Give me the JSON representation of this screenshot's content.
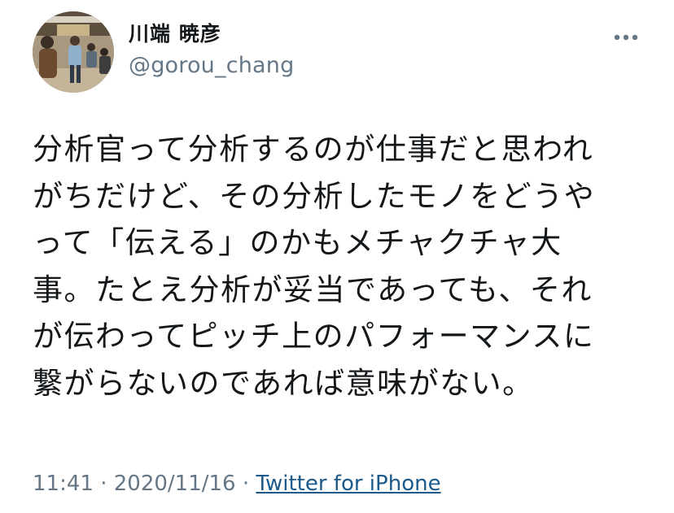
{
  "user": {
    "display_name": "川端 暁彦",
    "handle": "@gorou_chang"
  },
  "more_icon": "more-horizontal-icon",
  "tweet": {
    "text": "分析官って分析するのが仕事だと思われ\nがちだけど、その分析したモノをどうや\nって「伝える」のかもメチャクチャ大\n事。たとえ分析が妥当であっても、それ\nが伝わってピッチ上のパフォーマンスに\n繋がらないのであれば意味がない。",
    "time": "11:41",
    "separator": "·",
    "date": "2020/11/16",
    "source": "Twitter for iPhone"
  },
  "colors": {
    "text": "#14171a",
    "secondary": "#657786",
    "link": "#1b5a8a"
  }
}
